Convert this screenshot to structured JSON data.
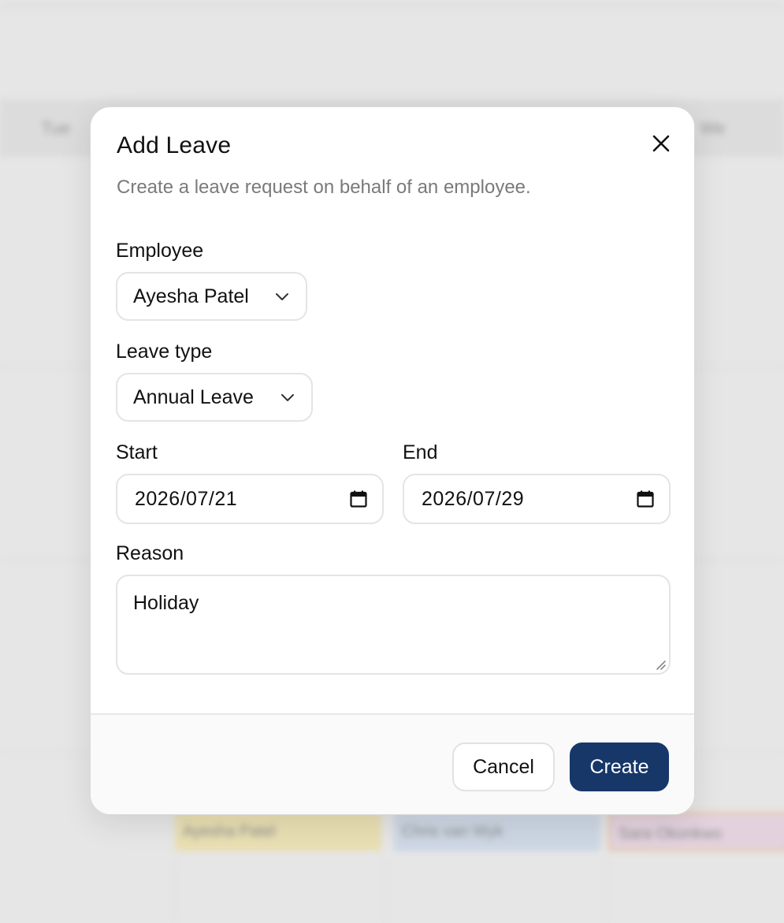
{
  "background": {
    "header_left": "Tue",
    "header_right": "We",
    "chips": [
      "Ayesha Patel",
      "Chris van Wyk",
      "Sara Okonkwo"
    ]
  },
  "dialog": {
    "title": "Add Leave",
    "subtitle": "Create a leave request on behalf of an employee.",
    "close_icon": "close-icon"
  },
  "form": {
    "employee": {
      "label": "Employee",
      "value": "Ayesha Patel"
    },
    "leave_type": {
      "label": "Leave type",
      "value": "Annual Leave"
    },
    "start": {
      "label": "Start",
      "value": "2026/07/21"
    },
    "end": {
      "label": "End",
      "value": "2026/07/29"
    },
    "reason": {
      "label": "Reason",
      "value": "Holiday"
    }
  },
  "footer": {
    "cancel_label": "Cancel",
    "create_label": "Create"
  },
  "colors": {
    "primary": "#173769",
    "border": "#e4e4e4",
    "muted_text": "#7a7a7a"
  }
}
